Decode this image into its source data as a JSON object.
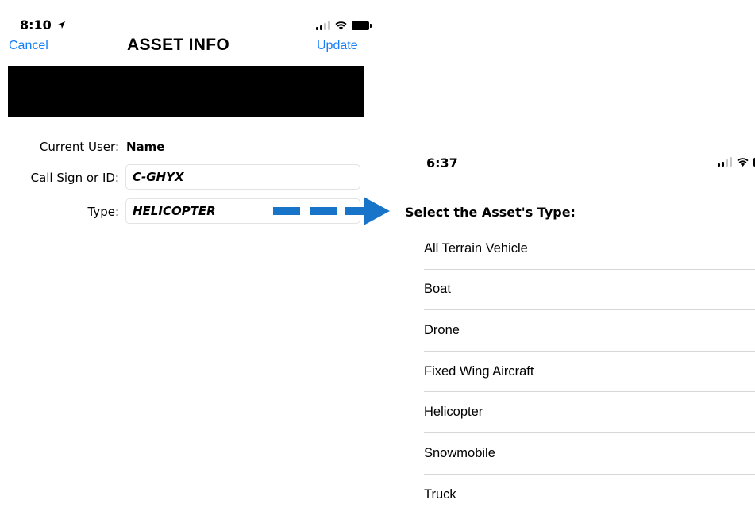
{
  "left_screen": {
    "status_bar": {
      "time": "8:10"
    },
    "nav": {
      "cancel_label": "Cancel",
      "title": "ASSET INFO",
      "update_label": "Update"
    },
    "form": {
      "current_user_label": "Current User:",
      "current_user_value": "Name",
      "call_sign_label": "Call Sign or ID:",
      "call_sign_value": "C-GHYX",
      "type_label": "Type:",
      "type_value": "HELICOPTER"
    }
  },
  "right_screen": {
    "status_bar": {
      "time": "6:37"
    },
    "heading": "Select the Asset's Type:",
    "asset_types": [
      "All Terrain Vehicle",
      "Boat",
      "Drone",
      "Fixed Wing Aircraft",
      "Helicopter",
      "Snowmobile",
      "Truck"
    ]
  },
  "colors": {
    "link_blue": "#147efb",
    "arrow_blue": "#1874c8"
  },
  "icons": [
    "location-arrow-icon",
    "signal-icon",
    "wifi-icon",
    "battery-icon",
    "arrow-right-icon"
  ]
}
